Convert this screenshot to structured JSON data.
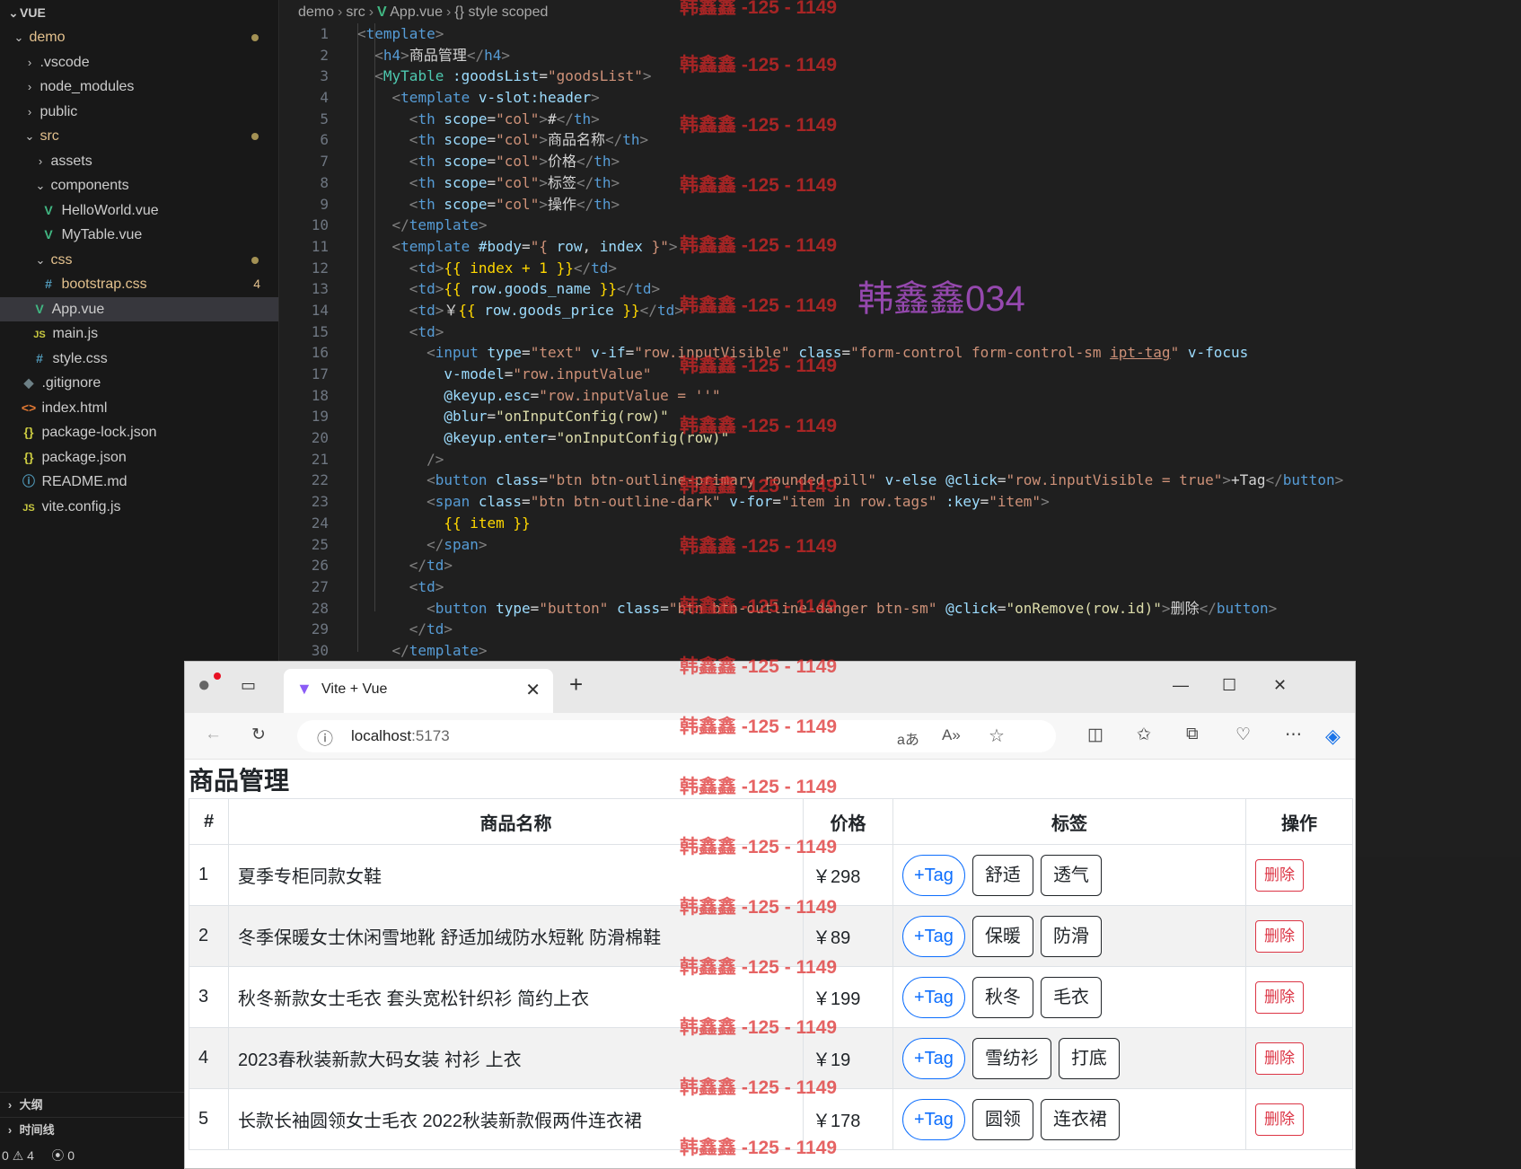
{
  "explorer": {
    "title": "VUE",
    "items": [
      {
        "label": "demo",
        "type": "folder"
      },
      {
        "label": ".vscode",
        "type": "folder"
      },
      {
        "label": "node_modules",
        "type": "folder"
      },
      {
        "label": "public",
        "type": "folder"
      },
      {
        "label": "src",
        "type": "folder"
      },
      {
        "label": "assets",
        "type": "folder"
      },
      {
        "label": "components",
        "type": "folder"
      },
      {
        "label": "HelloWorld.vue",
        "type": "vue"
      },
      {
        "label": "MyTable.vue",
        "type": "vue"
      },
      {
        "label": "css",
        "type": "folder"
      },
      {
        "label": "bootstrap.css",
        "type": "css",
        "badge": "4"
      },
      {
        "label": "App.vue",
        "type": "vue"
      },
      {
        "label": "main.js",
        "type": "js"
      },
      {
        "label": "style.css",
        "type": "css"
      },
      {
        "label": ".gitignore",
        "type": "git"
      },
      {
        "label": "index.html",
        "type": "html"
      },
      {
        "label": "package-lock.json",
        "type": "json"
      },
      {
        "label": "package.json",
        "type": "json"
      },
      {
        "label": "README.md",
        "type": "md"
      },
      {
        "label": "vite.config.js",
        "type": "js"
      }
    ],
    "outline_label": "大纲",
    "timeline_label": "时间线"
  },
  "statusbar": {
    "errors": "0",
    "warnings": "4",
    "ports": "0"
  },
  "breadcrumb": {
    "root": "demo",
    "folder": "src",
    "file": "App.vue",
    "symbol": "style scoped"
  },
  "line_numbers": [
    "1",
    "2",
    "3",
    "4",
    "5",
    "6",
    "7",
    "8",
    "9",
    "10",
    "11",
    "12",
    "13",
    "14",
    "15",
    "16",
    "17",
    "18",
    "19",
    "20",
    "21",
    "22",
    "23",
    "24",
    "25",
    "26",
    "27",
    "28",
    "29",
    "30"
  ],
  "code": {
    "t_template": "template",
    "t_h4": "h4",
    "h4_text": "商品管理",
    "t_mytable": "MyTable",
    "a_goodslist": ":goodsList",
    "v_goodslist": "\"goodsList\"",
    "a_vslot": "v-slot:header",
    "t_th": "th",
    "a_scope": "scope",
    "v_col": "\"col\"",
    "th1": "#",
    "th2": "商品名称",
    "th3": "价格",
    "th4": "标签",
    "th5": "操作",
    "a_body": "#body",
    "v_body_open": "\"{ ",
    "v_row": "row",
    "v_comma": ", ",
    "v_index": "index",
    "v_body_close": " }\"",
    "t_td": "td",
    "m_index": "{{ index + 1 }}",
    "m_open": "{{ ",
    "m_close": " }}",
    "v_goods_name": "row.goods_name",
    "yen": "￥",
    "v_goods_price": "row.goods_price",
    "t_input": "input",
    "a_type": "type",
    "v_text": "\"text\"",
    "a_vif": "v-if",
    "v_inputvisible": "\"row.inputVisible\"",
    "a_class": "class",
    "v_class_input_a": "\"form-control form-control-sm ",
    "v_class_input_b": "ipt-tag",
    "v_class_input_c": "\"",
    "a_vfocus": "v-focus",
    "a_vmodel": "v-model",
    "v_inputvalue": "\"row.inputValue\"",
    "a_keyupesc": "@keyup.esc",
    "v_esc": "\"row.inputValue = ''\"",
    "a_blur": "@blur",
    "v_onconfig": "\"onInputConfig(row)\"",
    "a_keyupenter": "@keyup.enter",
    "t_self_close": "/>",
    "t_button": "button",
    "v_btn_primary": "\"btn btn-outline-primary rounded-pill\"",
    "a_velse": "v-else",
    "a_click": "@click",
    "v_click_visible": "\"row.inputVisible = true\"",
    "plus_tag": "+Tag",
    "t_span": "span",
    "v_btn_dark": "\"btn btn-outline-dark\"",
    "a_vfor": "v-for",
    "v_vfor": "\"item in row.tags\"",
    "a_key": ":key",
    "v_item": "\"item\"",
    "m_item": "{{ item }}",
    "v_button": "\"button\"",
    "v_btn_danger": "\"btn btn-outline-danger btn-sm\"",
    "v_remove": "\"onRemove(row.id)\"",
    "del_text": "删除"
  },
  "browser": {
    "tab_title": "Vite + Vue",
    "url_host": "localhost",
    "url_port": ":5173",
    "page_title": "商品管理",
    "columns": [
      "#",
      "商品名称",
      "价格",
      "标签",
      "操作"
    ],
    "add_tag_label": "+Tag",
    "delete_label": "删除",
    "rows": [
      {
        "index": "1",
        "name": "夏季专柜同款女鞋",
        "price": "￥298",
        "tags": [
          "舒适",
          "透气"
        ]
      },
      {
        "index": "2",
        "name": "冬季保暖女士休闲雪地靴 舒适加绒防水短靴 防滑棉鞋",
        "price": "￥89",
        "tags": [
          "保暖",
          "防滑"
        ]
      },
      {
        "index": "3",
        "name": "秋冬新款女士毛衣 套头宽松针织衫 简约上衣",
        "price": "￥199",
        "tags": [
          "秋冬",
          "毛衣"
        ]
      },
      {
        "index": "4",
        "name": "2023春秋装新款大码女装 衬衫 上衣",
        "price": "￥19",
        "tags": [
          "雪纺衫",
          "打底"
        ]
      },
      {
        "index": "5",
        "name": "长款长袖圆领女士毛衣 2022秋装新款假两件连衣裙",
        "price": "￥178",
        "tags": [
          "圆领",
          "连衣裙"
        ]
      }
    ]
  },
  "watermark": {
    "text": "韩鑫鑫 -125 - 1149",
    "big": "韩鑫鑫034"
  },
  "colors": {
    "accent": "#0d6efd",
    "danger": "#dc3545",
    "vue_green": "#41b883",
    "modified": "#e2c08d"
  }
}
